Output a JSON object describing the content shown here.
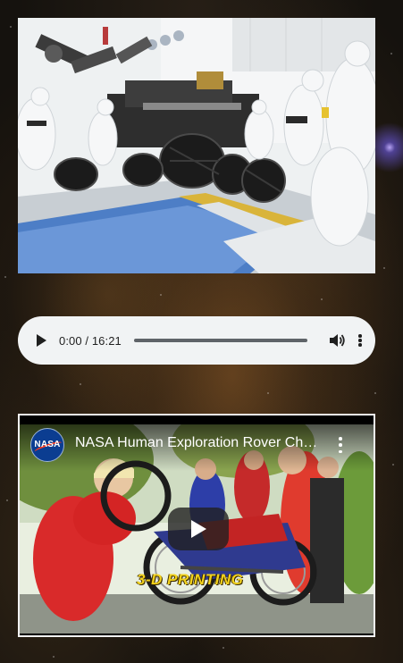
{
  "photo": {
    "alt_name": "rover-assembly-photo"
  },
  "audio": {
    "time_display": "0:00 / 16:21",
    "progress": 0,
    "play_icon": "play-icon",
    "volume_icon": "volume-icon",
    "more_icon": "more-vert-icon"
  },
  "video": {
    "channel_logo_text": "NASA",
    "title": "NASA Human Exploration Rover Challenge",
    "caption": "3-D PRINTING",
    "play_icon": "play-icon",
    "more_icon": "more-vert-icon"
  },
  "colors": {
    "audio_bg": "#f1f3f4",
    "video_frame": "#f2f2f2",
    "youtube_play_bg": "#212121",
    "caption_yellow": "#f2d21c",
    "nasa_blue": "#0b3d91",
    "nasa_red": "#fc3d21"
  }
}
